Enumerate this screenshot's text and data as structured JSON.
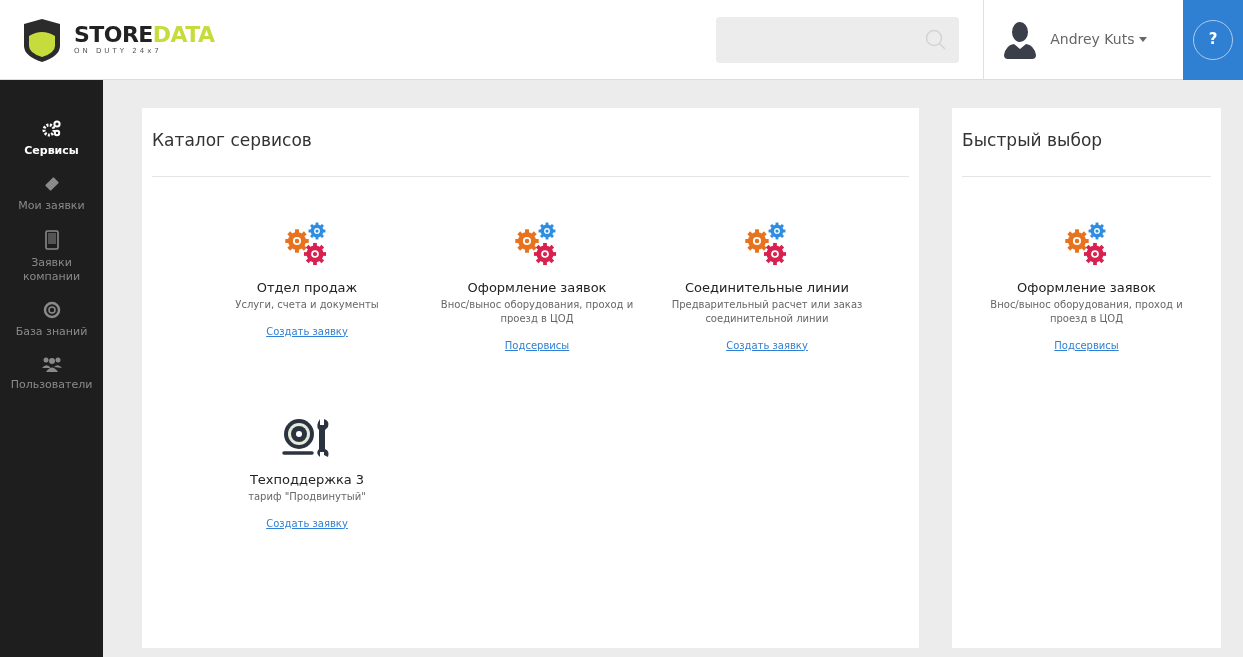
{
  "logo": {
    "word_1": "STORE",
    "word_2": "DATA",
    "tagline": "ON DUTY 24x7"
  },
  "header": {
    "user_name": "Andrey Kuts",
    "help": "?"
  },
  "sidebar": {
    "items": [
      {
        "label": "Сервисы",
        "kind": "gears",
        "selected": true
      },
      {
        "label": "Мои заявки",
        "kind": "ticket",
        "selected": false
      },
      {
        "label": "Заявки компании",
        "kind": "tablet",
        "selected": false
      },
      {
        "label": "База знаний",
        "kind": "lifebuoy",
        "selected": false
      },
      {
        "label": "Пользователи",
        "kind": "users",
        "selected": false
      }
    ]
  },
  "catalog": {
    "title": "Каталог сервисов",
    "services": [
      {
        "kind": "gears",
        "title": "Отдел продаж",
        "description": "Услуги, счета и документы",
        "link": "Создать заявку"
      },
      {
        "kind": "gears",
        "title": "Оформление заявок",
        "description": "Внос/вынос оборудования, проход и проезд в ЦОД",
        "link": "Подсервисы"
      },
      {
        "kind": "gears",
        "title": "Соединительные линии",
        "description": "Предварительный расчет или заказ соединительной линии",
        "link": "Создать заявку"
      },
      {
        "kind": "tools",
        "title": "Техподдержка 3",
        "description": "тариф \"Продвинутый\"",
        "link": "Создать заявку"
      }
    ]
  },
  "quick_pick": {
    "title": "Быстрый выбор",
    "services": [
      {
        "kind": "gears",
        "title": "Оформление заявок",
        "description": "Внос/вынос оборудования, проход и проезд в ЦОД",
        "link": "Подсервисы"
      }
    ]
  }
}
